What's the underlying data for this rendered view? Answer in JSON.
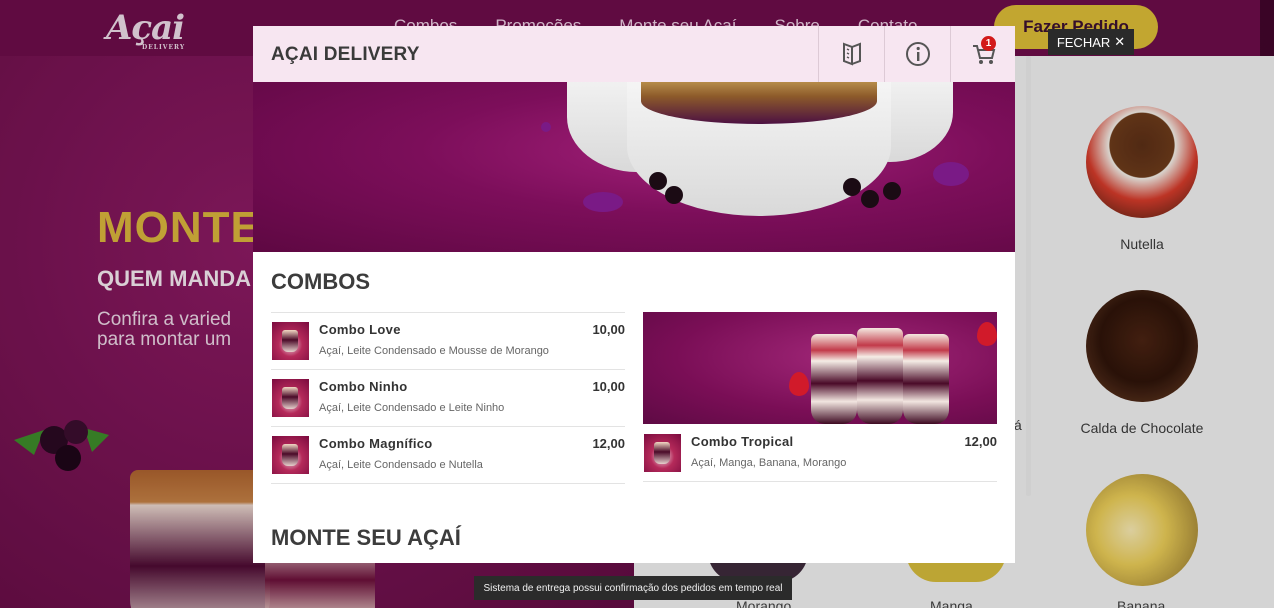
{
  "background": {
    "logo_text": "Açai",
    "logo_subtext": "DELIVERY",
    "nav_links": [
      "Combos",
      "Promoções",
      "Monte seu Açaí",
      "Sobre",
      "Contato"
    ],
    "order_button": "Fazer Pedido",
    "hero_title": "MONTE",
    "hero_subtitle": "QUEM MANDA",
    "hero_text": "Confira a varied para montar um",
    "ingredients": [
      "Nutella",
      "Calda de Chocolate",
      "Banana"
    ],
    "bottom_labels": [
      "Morango",
      "Manga"
    ],
    "partial_label": "á"
  },
  "close_button": {
    "label": "FECHAR",
    "icon": "close-icon"
  },
  "modal": {
    "title": "AÇAI DELIVERY",
    "header_icons": [
      "menu-book-icon",
      "info-icon",
      "cart-icon"
    ],
    "cart_count": "1",
    "sections": {
      "combos_title": "COMBOS",
      "monte_title": "MONTE SEU AÇAÍ"
    },
    "combos": [
      {
        "name": "Combo Love",
        "price": "10,00",
        "description": "Açaí, Leite Condensado e Mousse de Morango"
      },
      {
        "name": "Combo Ninho",
        "price": "10,00",
        "description": "Açaí, Leite Condensado e Leite Ninho"
      },
      {
        "name": "Combo Magnífico",
        "price": "12,00",
        "description": "Açaí, Leite Condensado e Nutella"
      }
    ],
    "featured": {
      "name": "Combo Tropical",
      "price": "12,00",
      "description": "Açaí, Manga, Banana, Morango"
    }
  },
  "toast": "Sistema de entrega possui confirmação dos pedidos em tempo real",
  "colors": {
    "brand": "#7c0e5a",
    "accent": "#d9b936",
    "header_bg": "#f6e4f0",
    "badge": "#d21a1a"
  }
}
